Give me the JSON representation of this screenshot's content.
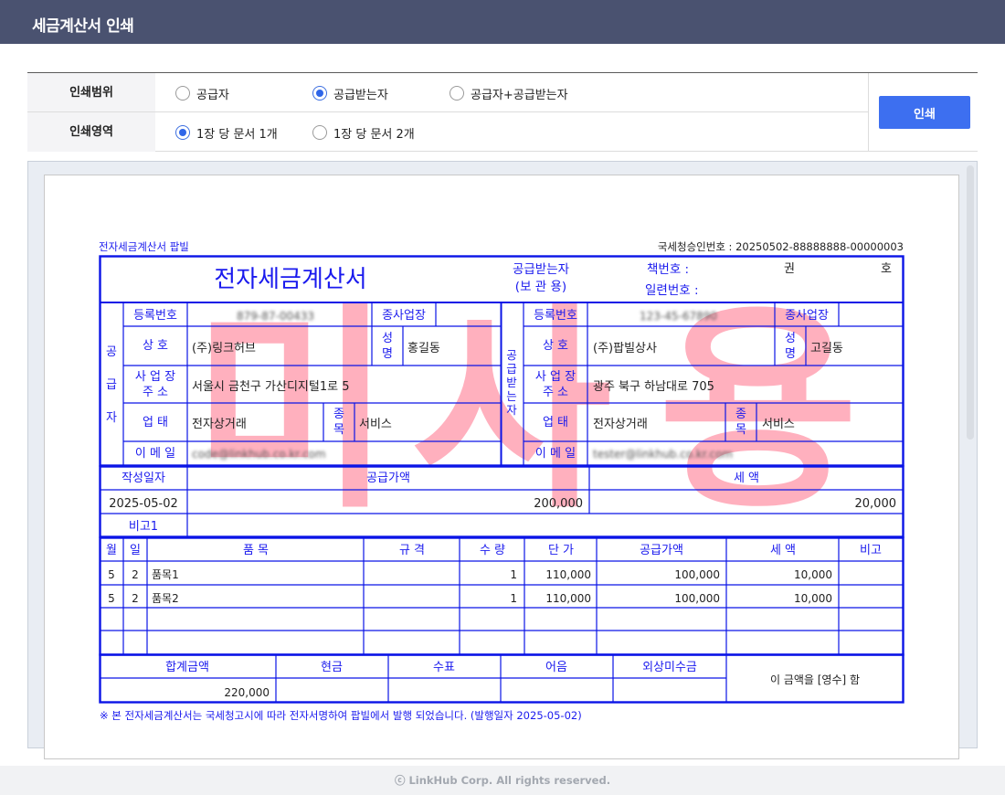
{
  "window": {
    "title": "세금계산서 인쇄"
  },
  "options": {
    "range_label": "인쇄범위",
    "area_label": "인쇄영역",
    "range_choices": [
      {
        "label": "공급자",
        "selected": false
      },
      {
        "label": "공급받는자",
        "selected": true
      },
      {
        "label": "공급자+공급받는자",
        "selected": false
      }
    ],
    "area_choices": [
      {
        "label": "1장 당 문서 1개",
        "selected": true
      },
      {
        "label": "1장 당 문서 2개",
        "selected": false
      }
    ],
    "print_button": "인쇄"
  },
  "invoice": {
    "top_left": "전자세금계산서 팝빌",
    "approval": "국세청승인번호 : 20250502-88888888-00000003",
    "title": "전자세금계산서",
    "copy_type": "공급받는자",
    "copy_note": "(보 관 용)",
    "book_label": "책번호 :",
    "serial_label": "일련번호 :",
    "kwon": "권",
    "ho": "호",
    "watermark": "미사용",
    "supplier": {
      "side_label": [
        "공",
        "급",
        "자"
      ],
      "reg_label": "등록번호",
      "reg_no": "879-87-00433",
      "branch_label": "종사업장",
      "name_label": "상 호",
      "name": "(주)링크허브",
      "ceo_label": [
        "성",
        "명"
      ],
      "ceo": "홍길동",
      "addr_label": [
        "사 업 장",
        "주 소"
      ],
      "addr": "서울시 금천구 가산디지털1로 5",
      "biztype_label": "업 태",
      "biztype": "전자상거래",
      "item_label": [
        "종",
        "목"
      ],
      "item": "서비스",
      "email_label": "이 메 일",
      "email": "code@linkhub.co.kr.com"
    },
    "buyer": {
      "side_label": [
        "공",
        "급",
        "받",
        "는",
        "자"
      ],
      "reg_label": "등록번호",
      "reg_no": "123-45-67890",
      "branch_label": "종사업장",
      "name_label": "상 호",
      "name": "(주)팝빌상사",
      "ceo_label": [
        "성",
        "명"
      ],
      "ceo": "고길동",
      "addr_label": [
        "사 업 장",
        "주 소"
      ],
      "addr": "광주 북구 하남대로 705",
      "biztype_label": "업 태",
      "biztype": "전자상거래",
      "item_label": [
        "종",
        "목"
      ],
      "item": "서비스",
      "email_label": "이 메 일",
      "email": "tester@linkhub.co.kr.com"
    },
    "summary": {
      "date_label": "작성일자",
      "supply_label": "공급가액",
      "tax_label": "세 액",
      "date": "2025-05-02",
      "supply": "200,000",
      "tax": "20,000",
      "remark_label": "비고1"
    },
    "items_header": [
      "월",
      "일",
      "품 목",
      "규 격",
      "수 량",
      "단 가",
      "공급가액",
      "세 액",
      "비고"
    ],
    "items": [
      [
        "5",
        "2",
        "품목1",
        "",
        "1",
        "110,000",
        "100,000",
        "10,000",
        ""
      ],
      [
        "5",
        "2",
        "품목2",
        "",
        "1",
        "110,000",
        "100,000",
        "10,000",
        ""
      ],
      [
        "",
        "",
        "",
        "",
        "",
        "",
        "",
        "",
        ""
      ],
      [
        "",
        "",
        "",
        "",
        "",
        "",
        "",
        "",
        ""
      ]
    ],
    "totals": {
      "total_label": "합계금액",
      "cash_label": "현금",
      "check_label": "수표",
      "note_label": "어음",
      "credit_label": "외상미수금",
      "total": "220,000",
      "receipt": "이 금액을 [영수] 함"
    },
    "footnote": "※ 본 전자세금계산서는 국세청고시에 따라 전자서명하여 팝빌에서 발행 되었습니다. (발행일자 2025-05-02)"
  },
  "footer": {
    "copyright": "ⓒ LinkHub Corp. All rights reserved."
  },
  "colors": {
    "titlebar": "#4a5270",
    "accent": "#3d6ff0",
    "invoice_line": "#0a14e6",
    "watermark": "#ff8fa3"
  }
}
